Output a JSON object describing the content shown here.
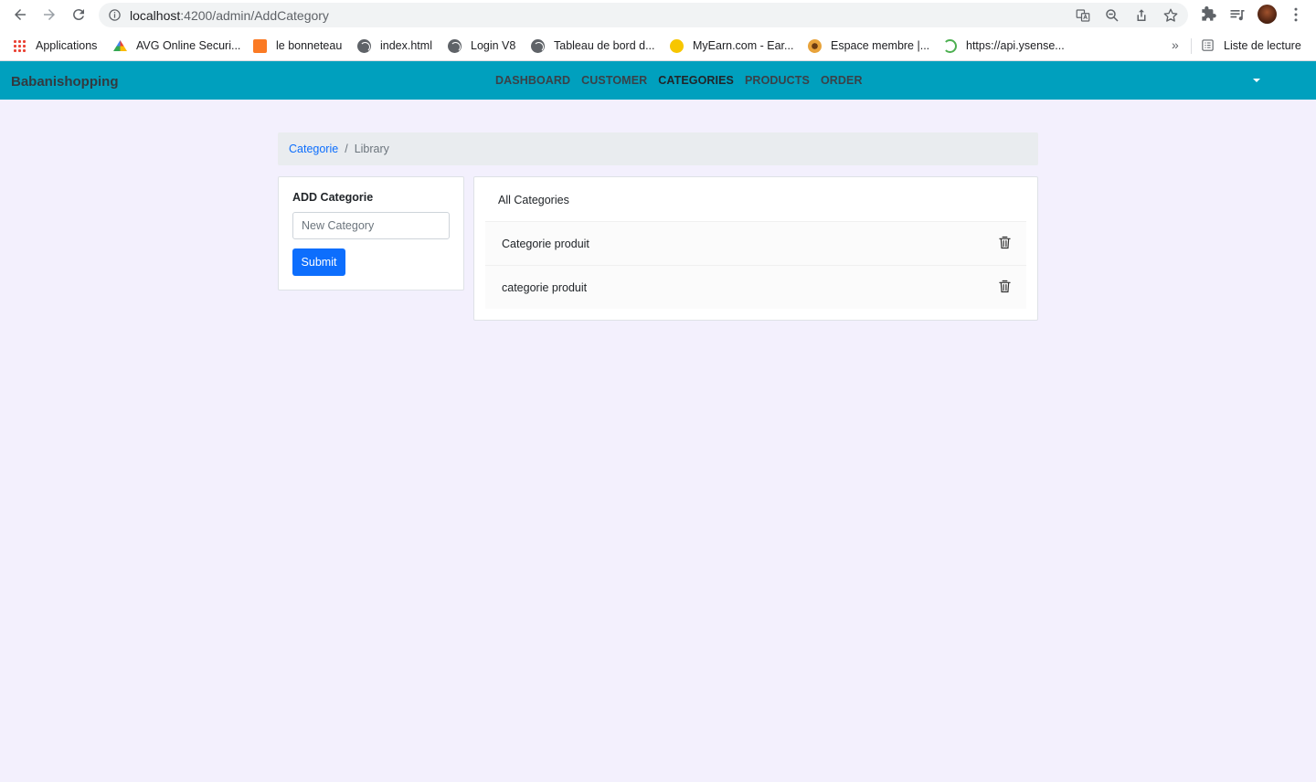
{
  "browser": {
    "url_host": "localhost",
    "url_path": ":4200/admin/AddCategory",
    "bookmarks": [
      {
        "label": "Applications"
      },
      {
        "label": "AVG Online Securi..."
      },
      {
        "label": "le bonneteau"
      },
      {
        "label": "index.html"
      },
      {
        "label": "Login V8"
      },
      {
        "label": "Tableau de bord d..."
      },
      {
        "label": "MyEarn.com - Ear..."
      },
      {
        "label": "Espace membre |..."
      },
      {
        "label": "https://api.ysense..."
      }
    ],
    "more_label": "»",
    "reading_list": "Liste de lecture"
  },
  "app": {
    "brand": "Babanishopping",
    "nav": [
      {
        "label": "DASHBOARD"
      },
      {
        "label": "CUSTOMER"
      },
      {
        "label": "CATEGORIES",
        "active": true
      },
      {
        "label": "PRODUCTS"
      },
      {
        "label": "ORDER"
      }
    ],
    "accent": "#00a0be"
  },
  "breadcrumb": {
    "link": "Categorie",
    "separator": "/",
    "current": "Library"
  },
  "add_form": {
    "title": "ADD Categorie",
    "placeholder": "New Category",
    "value": "",
    "submit_label": "Submit"
  },
  "categories": {
    "title": "All Categories",
    "items": [
      {
        "name": "Categorie produit"
      },
      {
        "name": "categorie produit"
      }
    ]
  }
}
